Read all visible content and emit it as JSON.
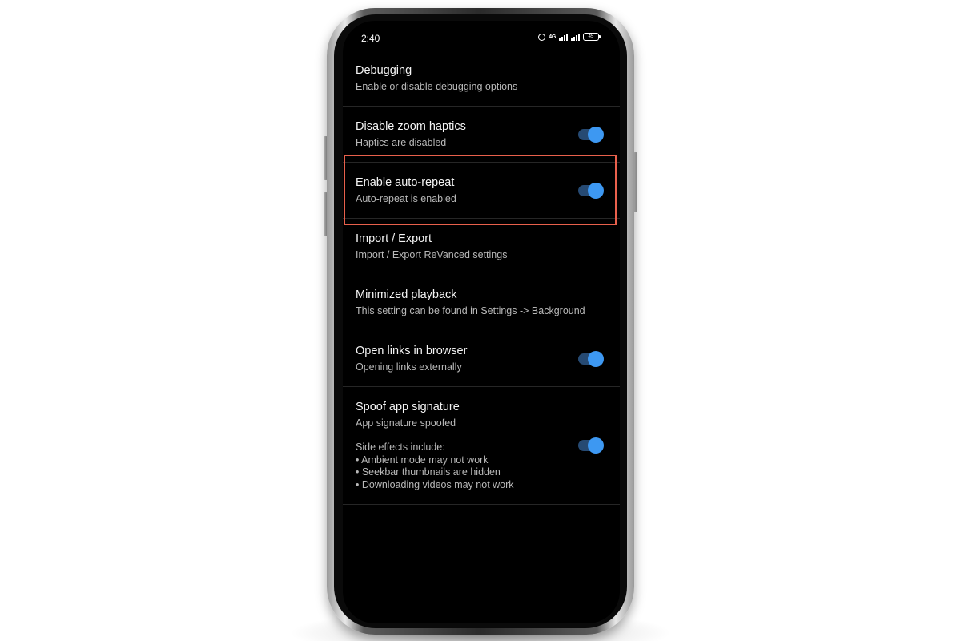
{
  "status_bar": {
    "time": "2:40",
    "network_label": "4G",
    "battery_level": "45",
    "icons": [
      "alarm-icon",
      "network-icon",
      "signal-icon",
      "signal-icon",
      "battery-icon"
    ]
  },
  "settings": [
    {
      "title": "Debugging",
      "summary": "Enable or disable debugging options",
      "toggle": null
    },
    {
      "title": "Disable zoom haptics",
      "summary": "Haptics are disabled",
      "toggle": true
    },
    {
      "title": "Enable auto-repeat",
      "summary": "Auto-repeat is enabled",
      "toggle": true,
      "highlighted": true
    },
    {
      "title": "Import / Export",
      "summary": "Import / Export ReVanced settings",
      "toggle": null
    },
    {
      "title": "Minimized playback",
      "summary": "This setting can be found in Settings -> Background",
      "toggle": null
    },
    {
      "title": "Open links in browser",
      "summary": "Opening links externally",
      "toggle": true
    },
    {
      "title": "Spoof app signature",
      "summary": "App signature spoofed",
      "details": [
        "Side effects include:",
        "• Ambient mode may not work",
        "• Seekbar thumbnails are hidden",
        "• Downloading videos may not work"
      ],
      "toggle": true
    }
  ],
  "colors": {
    "background": "#000000",
    "toggle_track": "#264a73",
    "toggle_knob": "#3d98f2",
    "highlight": "#e8604c"
  }
}
